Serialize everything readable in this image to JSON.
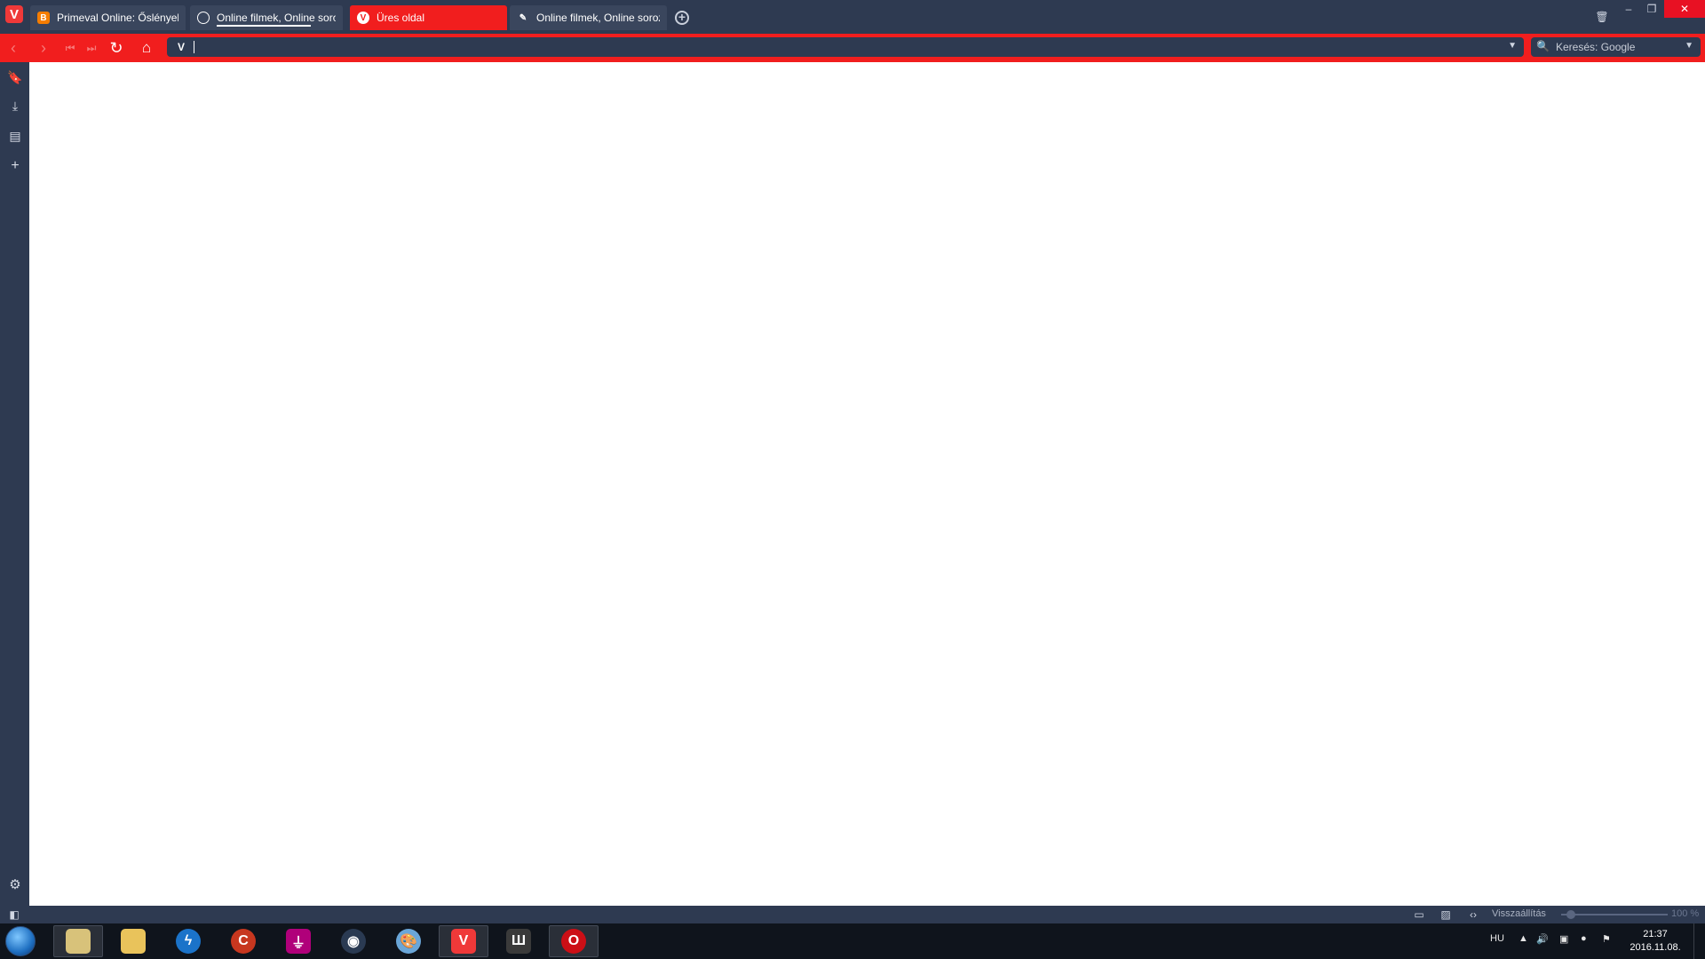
{
  "browser": {
    "tabs": [
      {
        "title": "Primeval Online: Őslények k",
        "favicon": "blogger-icon",
        "active": false
      },
      {
        "title": "Online filmek, Online soroz",
        "favicon": "globe-icon",
        "active": false
      },
      {
        "title": "Üres oldal",
        "favicon": "vivaldi-icon",
        "active": true
      },
      {
        "title": "Online filmek, Online soroz",
        "favicon": "pin-icon",
        "active": false
      }
    ],
    "address": {
      "value": "",
      "badge": "V"
    },
    "search": {
      "placeholder": "Keresés: Google"
    },
    "accent_color": "#f11e1e",
    "chrome_color": "#2e3a51"
  },
  "statusbar": {
    "reset_label": "Visszaállítás",
    "zoom": "100 %"
  },
  "taskbar": {
    "language": "HU",
    "time": "21:37",
    "date": "2016.11.08."
  }
}
